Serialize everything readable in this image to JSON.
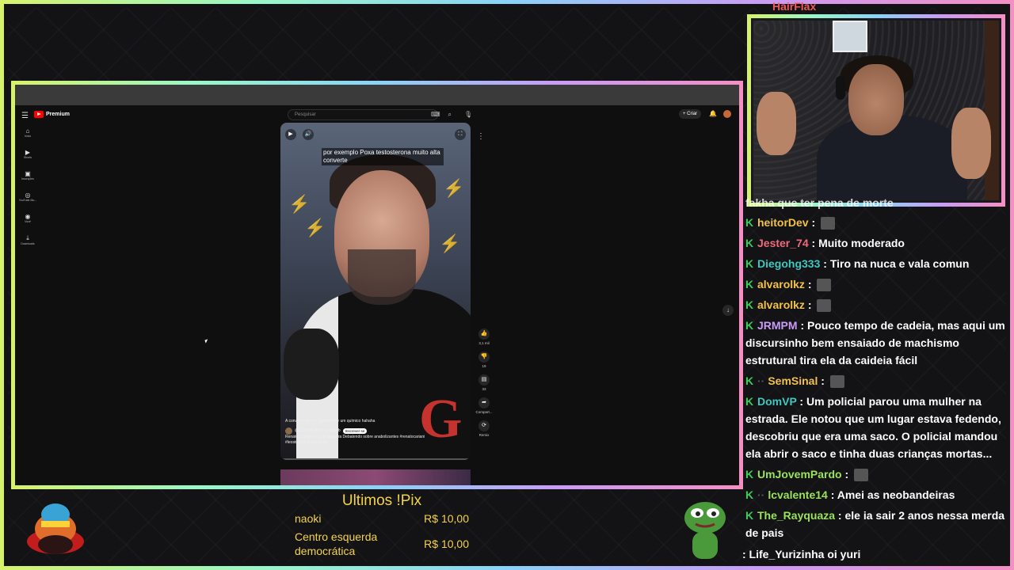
{
  "youtube": {
    "logo_text": "Premium",
    "search_placeholder": "Pesquisar",
    "create_label": "+ Criar",
    "sidebar": [
      {
        "icon": "home-icon",
        "glyph": "⌂",
        "label": "Início"
      },
      {
        "icon": "shorts-icon",
        "glyph": "▶",
        "label": "Shorts"
      },
      {
        "icon": "subscriptions-icon",
        "glyph": "▣",
        "label": "Inscrições"
      },
      {
        "icon": "youtube-music-icon",
        "glyph": "◎",
        "label": "YouTube Mu..."
      },
      {
        "icon": "you-icon",
        "glyph": "◉",
        "label": "Você"
      },
      {
        "icon": "downloads-icon",
        "glyph": "⤓",
        "label": "Downloads"
      }
    ],
    "short": {
      "caption": "por exemplo Poxa testosterona muito alta converte",
      "title": "A conversa de um alquimista e um químico hahaha",
      "channel": "@CortesBrilhantes-dg3pb",
      "subscribe": "Inscrever-se",
      "description": "Renato Cariani e o Léo Siqueira Debatendo sobre anabolizantes #renatocariani #leostronda #fitne #viral"
    },
    "actions": [
      {
        "icon": "like-icon",
        "glyph": "👍",
        "label": "3,1 mil"
      },
      {
        "icon": "dislike-icon",
        "glyph": "👎",
        "label": "19"
      },
      {
        "icon": "comments-icon",
        "glyph": "▤",
        "label": "33"
      },
      {
        "icon": "share-icon",
        "glyph": "➦",
        "label": "Compart..."
      },
      {
        "icon": "remix-icon",
        "glyph": "⟳",
        "label": "Remix"
      }
    ]
  },
  "webcam": {
    "partial_name": "HairFlax"
  },
  "chat": {
    "partial_text": "fakha que ter pena de morte",
    "messages": [
      {
        "user": "heitorDev",
        "color": "#f3c14a",
        "text": "",
        "emote": true
      },
      {
        "user": "Jester_74",
        "color": "#ef6a7a",
        "text": "Muito moderado",
        "emote": false
      },
      {
        "user": "Diegohg333",
        "color": "#3fc8c0",
        "text": "Tiro na nuca e vala comun",
        "emote": false
      },
      {
        "user": "alvarolkz",
        "color": "#f3c14a",
        "text": "",
        "emote": true
      },
      {
        "user": "alvarolkz",
        "color": "#f3c14a",
        "text": "",
        "emote": true
      },
      {
        "user": "JRMPM",
        "color": "#c99cf5",
        "text": "Pouco tempo de cadeia, mas aqui um discursinho bem ensaiado de machismo estrutural tira ela da caideia fácil",
        "emote": false
      },
      {
        "user": "SemSinal",
        "color": "#f3c14a",
        "text": "",
        "emote": true,
        "dots": true
      },
      {
        "user": "DomVP",
        "color": "#3fc8c0",
        "text": "Um policial parou uma mulher na estrada. Ele notou que um lugar estava fedendo, descobriu que era uma saco. O policial mandou ela abrir o saco e tinha duas crianças mortas...",
        "emote": false
      },
      {
        "user": "UmJovemPardo",
        "color": "#9ae35a",
        "text": "",
        "emote": true
      },
      {
        "user": "lcvalente14",
        "color": "#9ae35a",
        "text": "Amei as neobandeiras",
        "emote": false,
        "dots": true
      },
      {
        "user": "The_Rayquaza",
        "color": "#9ae35a",
        "text": "ele ia sair 2 anos nessa merda de pais",
        "emote": false
      }
    ],
    "last_line": ": Life_Yurizinha oi yuri"
  },
  "pix": {
    "title": "Ultimos !Pix",
    "entries": [
      {
        "name": "naoki",
        "amount": "R$ 10,00"
      },
      {
        "name": "Centro esquerda democrática",
        "amount": "R$ 10,00"
      }
    ]
  },
  "colors": {
    "accent_gold": "#f3d34a",
    "badge_green": "#3ccd5a"
  }
}
